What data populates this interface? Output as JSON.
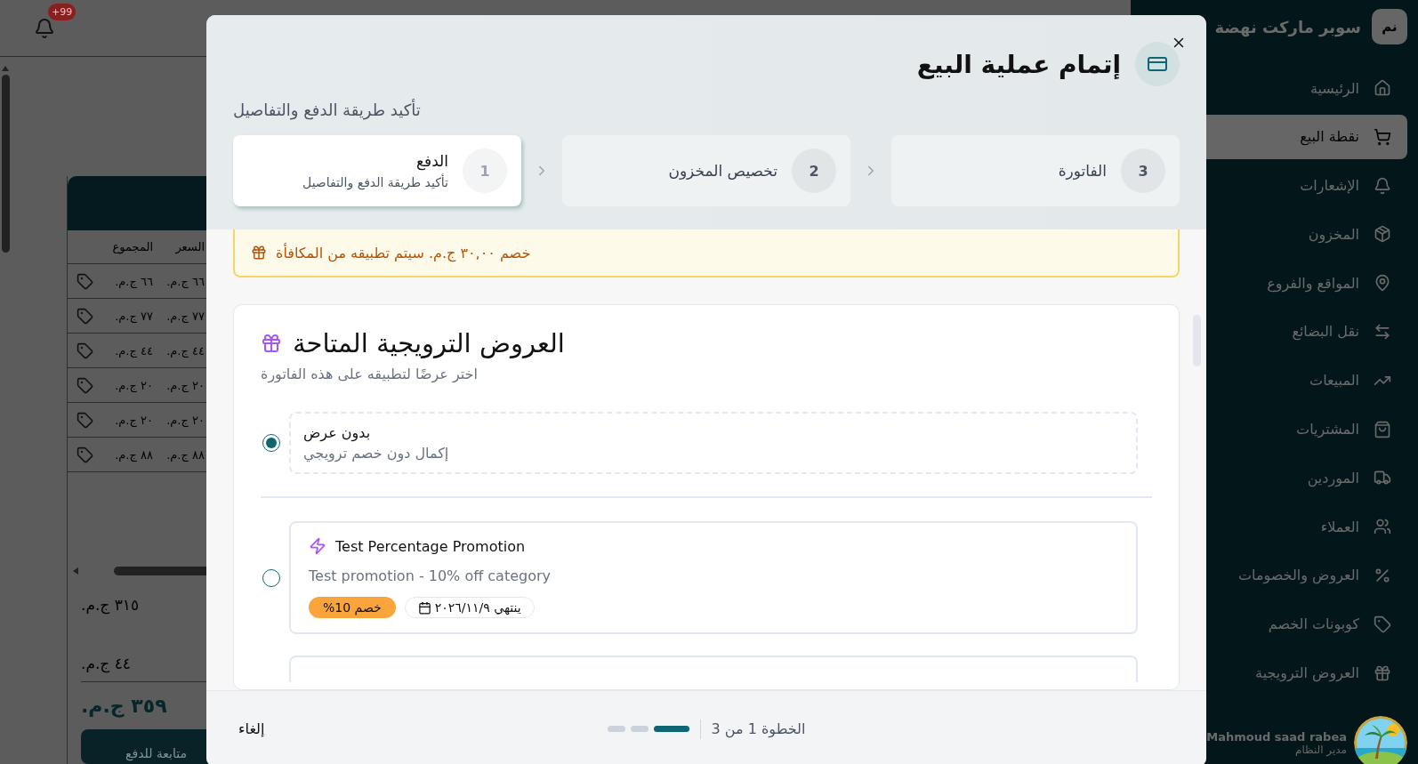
{
  "top_bar": {
    "notification_badge": "+99"
  },
  "cart": {
    "columns": [
      "السعر",
      "المجموع"
    ],
    "rows": [
      {
        "price": "٦٦ ج.م.",
        "total": "٦٦ ج.م."
      },
      {
        "price": "٧٧ ج.م.",
        "total": "٧٧ ج.م."
      },
      {
        "price": "٤٤ ج.م.",
        "total": "٤٤ ج.م."
      },
      {
        "price": "٢٠ ج.م.",
        "total": "٢٠ ج.م."
      },
      {
        "price": "٢٠ ج.م.",
        "total": "٢٠ ج.م."
      },
      {
        "price": "٨٨ ج.م.",
        "total": "٨٨ ج.م."
      }
    ],
    "subtotal": "٣١٥ ج.م.",
    "tax": "٤٤ ج.م.",
    "total": "٣٥٩ ج.م.",
    "checkout_button": "متابعة للدفع"
  },
  "sidebar": {
    "logo": "نم",
    "store_name": "سوبر ماركت نهضة",
    "items": [
      {
        "label": "الرئيسية",
        "selected": false
      },
      {
        "label": "نقطة البيع",
        "selected": true
      },
      {
        "label": "الإشعارات",
        "selected": false
      },
      {
        "label": "المخزون",
        "selected": false
      },
      {
        "label": "المواقع والفروع",
        "selected": false
      },
      {
        "label": "نقل البضائع",
        "selected": false
      },
      {
        "label": "المبيعات",
        "selected": false
      },
      {
        "label": "المشتريات",
        "selected": false
      },
      {
        "label": "الموردين",
        "selected": false
      },
      {
        "label": "العملاء",
        "selected": false
      },
      {
        "label": "العروض والخصومات",
        "selected": false
      },
      {
        "label": "كوبونات الخصم",
        "selected": false
      },
      {
        "label": "العروض الترويجية",
        "selected": false
      }
    ],
    "user": {
      "name": "Mahmoud saad rabea",
      "role": "مدير النظام"
    }
  },
  "dialog": {
    "title": "إتمام عملية البيع",
    "subtitle": "تأكيد طريقة الدفع والتفاصيل",
    "steps": [
      {
        "number": "3",
        "title": "الفاتورة",
        "selected": false
      },
      {
        "number": "2",
        "title": "تخصيص المخزون",
        "selected": false
      },
      {
        "number": "1",
        "title": "الدفع",
        "description": "تأكيد طريقة الدفع والتفاصيل",
        "selected": true
      }
    ],
    "reward_notice": "خصم ٣٠,٠٠ ج.م. سيتم تطبيقه من المكافأة",
    "promotions": {
      "title": "العروض الترويجية المتاحة",
      "subtitle": "اختر عرضًا لتطبيقه على هذه الفاتورة",
      "options": [
        {
          "kind": "none",
          "title": "بدون عرض",
          "description": "إكمال دون خصم ترويجي",
          "selected": true
        },
        {
          "kind": "promotion",
          "title": "Test Percentage Promotion",
          "description": "Test promotion - 10% off category",
          "discount": "خصم 10%",
          "expiry": "ينتهي ٢٠٢٦/١١/٩",
          "selected": false
        }
      ]
    },
    "step_indicator": "الخطوة 1 من 3",
    "cancel_button": "إلغاء"
  }
}
